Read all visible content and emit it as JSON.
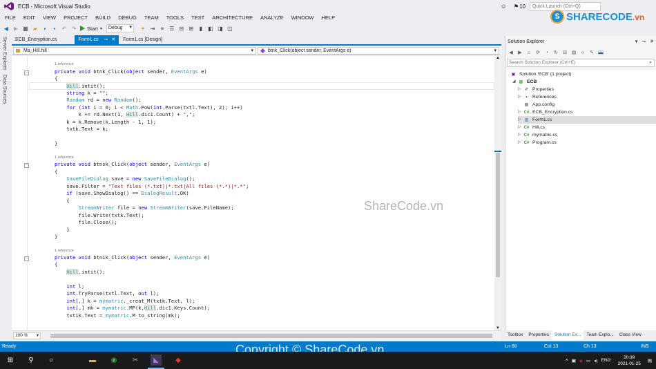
{
  "window": {
    "title": "ECB - Microsoft Visual Studio",
    "notification_count": "10",
    "quick_launch_placeholder": "Quick Launch (Ctrl+Q)"
  },
  "logo": {
    "name": "SHARECODE",
    "suffix": ".vn"
  },
  "menu": [
    "FILE",
    "EDIT",
    "VIEW",
    "PROJECT",
    "BUILD",
    "DEBUG",
    "TEAM",
    "TOOLS",
    "TEST",
    "ARCHITECTURE",
    "ANALYZE",
    "WINDOW",
    "HELP"
  ],
  "toolbar": {
    "start_label": "Start",
    "config": "Debug"
  },
  "left_strip": [
    "Server Explorer",
    "Data Sources"
  ],
  "doc_tabs": [
    {
      "label": "ECB_Encryption.cs",
      "active": false
    },
    {
      "label": "Form1.cs",
      "active": true
    },
    {
      "label": "Form1.cs [Design]",
      "active": false
    }
  ],
  "navbar": {
    "class_select": "Ma_Hill.hill",
    "member_select": "btnk_Click(object sender, EventArgs e)"
  },
  "code": {
    "ref_label": "1 reference",
    "lines": [
      "private void btnk_Click(object sender, EventArgs e)",
      "{",
      "Hill.intit();",
      "string k = \"\";",
      "Random rd = new Random();",
      "for (int i = 0; i < Math.Pow(int.Parse(txtl.Text), 2); i++)",
      "k += rd.Next(1, Hill.dic1.Count) + \",\";",
      "k = k.Remove(k.Length - 1, 1);",
      "txtk.Text = k;",
      "}",
      "private void btnsk_Click(object sender, EventArgs e)",
      "{",
      "SaveFileDialog save = new SaveFileDialog();",
      "save.Filter = \"Text files (*.txt)|*.txt|All files (*.*)|*.*\";",
      "if (save.ShowDialog() == DialogResult.OK)",
      "{",
      "StreamWriter file = new StreamWriter(save.FileName);",
      "file.Write(txtk.Text);",
      "file.Close();",
      "}",
      "}",
      "private void btnik_Click(object sender, EventArgs e)",
      "{",
      "Hill.intit();",
      "int l;",
      "int.TryParse(txtl.Text, out l);",
      "int[,] k = mymatric._creat_M(txtk.Text, l);",
      "int[,] mk = mymatric.MP(k,Hill.dic1.Keys.Count);",
      "txtik.Text = mymatric.M_to_string(mk);"
    ]
  },
  "watermark": "ShareCode.vn",
  "zoom": "100 %",
  "solution_explorer": {
    "title": "Solution Explorer",
    "search_placeholder": "Search Solution Explorer (Ctrl+E)",
    "solution": "Solution 'ECB' (1 project)",
    "project": "ECB",
    "items": [
      "Properties",
      "References",
      "App.config",
      "ECB_Encryption.cs",
      "Form1.cs",
      "Hill.cs",
      "mymatric.cs",
      "Program.cs"
    ],
    "selected": "Form1.cs",
    "tabs": [
      "Toolbox",
      "Properties",
      "Solution Ex...",
      "Team Explo...",
      "Class View"
    ]
  },
  "status": {
    "left": "Ready",
    "line": "Ln 66",
    "col": "Col 13",
    "ch": "Ch 13",
    "mode": "INS"
  },
  "copyright": "Copyright © ShareCode.vn",
  "taskbar": {
    "time": "20:39",
    "date": "2021-01-25",
    "lang": "ENG"
  },
  "colors": {
    "accent": "#007acc",
    "keyword": "#0000ff",
    "type": "#2b91af",
    "string": "#a31515"
  }
}
